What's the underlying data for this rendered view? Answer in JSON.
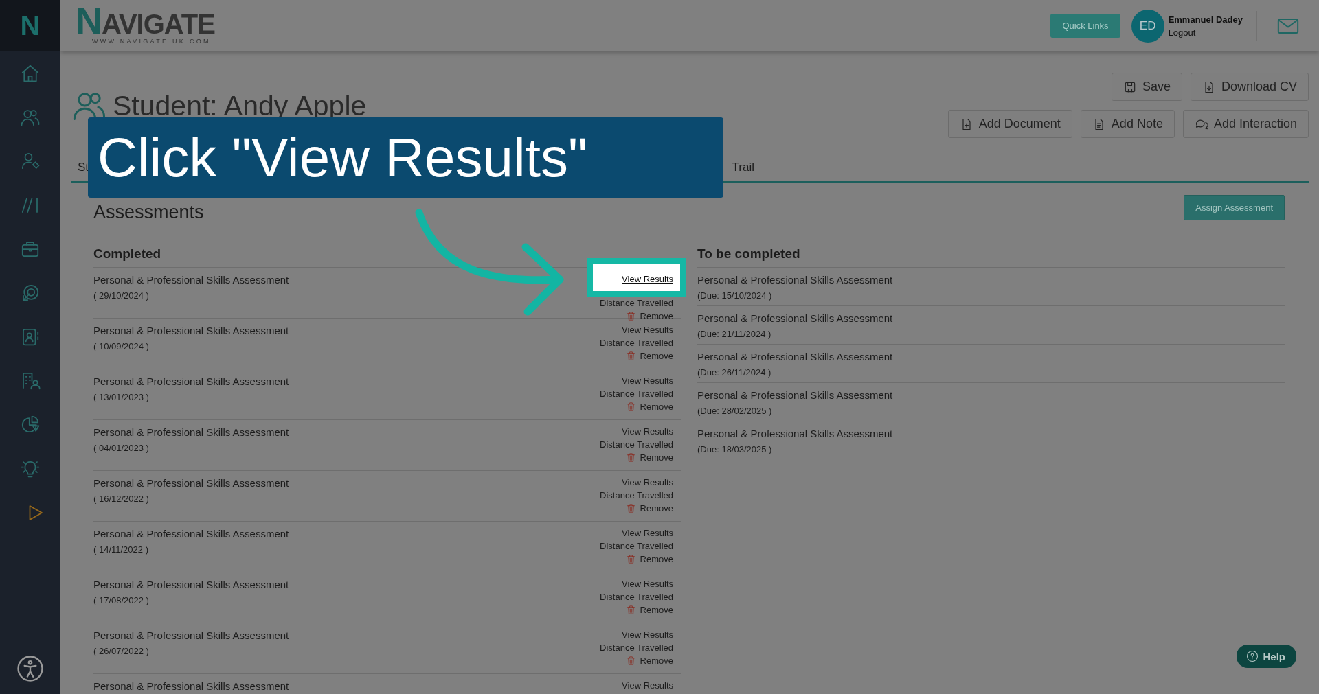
{
  "sidebar": {
    "logo": "N"
  },
  "header": {
    "logo": "NAVIGATE",
    "tagline": "WWW.NAVIGATE.UK.COM",
    "quick_links": "Quick Links",
    "user": {
      "initials": "ED",
      "name": "Emmanuel Dadey",
      "logout": "Logout"
    }
  },
  "student": {
    "title": "Student: Andy Apple",
    "buttons": [
      [
        "Save",
        "Download CV"
      ],
      [
        "Add Document",
        "Add Note",
        "Add Interaction"
      ]
    ]
  },
  "tabs": [
    {
      "label": "St"
    },
    {
      "label": "Trail"
    }
  ],
  "assessments": {
    "title": "Assessments",
    "assign_button": "Assign Assessment",
    "completed": {
      "heading": "Completed",
      "rows": [
        {
          "title": "Personal & Professional Skills Assessment",
          "date": "( 29/10/2024 )",
          "highlighted": true,
          "actions": [
            "View Results",
            "Distance Travelled",
            "Remove"
          ]
        },
        {
          "title": "Personal & Professional Skills Assessment",
          "date": "( 10/09/2024 )",
          "highlighted": false,
          "actions": [
            "View Results",
            "Distance Travelled",
            "Remove"
          ]
        },
        {
          "title": "Personal & Professional Skills Assessment",
          "date": "( 13/01/2023 )",
          "highlighted": false,
          "actions": [
            "View Results",
            "Distance Travelled",
            "Remove"
          ]
        },
        {
          "title": "Personal & Professional Skills Assessment",
          "date": "( 04/01/2023 )",
          "highlighted": false,
          "actions": [
            "View Results",
            "Distance Travelled",
            "Remove"
          ]
        },
        {
          "title": "Personal & Professional Skills Assessment",
          "date": "( 16/12/2022 )",
          "highlighted": false,
          "actions": [
            "View Results",
            "Distance Travelled",
            "Remove"
          ]
        },
        {
          "title": "Personal & Professional Skills Assessment",
          "date": "( 14/11/2022 )",
          "highlighted": false,
          "actions": [
            "View Results",
            "Distance Travelled",
            "Remove"
          ]
        },
        {
          "title": "Personal & Professional Skills Assessment",
          "date": "( 17/08/2022 )",
          "highlighted": false,
          "actions": [
            "View Results",
            "Distance Travelled",
            "Remove"
          ]
        },
        {
          "title": "Personal & Professional Skills Assessment",
          "date": "( 26/07/2022 )",
          "highlighted": false,
          "actions": [
            "View Results",
            "Distance Travelled",
            "Remove"
          ]
        },
        {
          "title": "Personal & Professional Skills Assessment",
          "highlighted": false,
          "actions": [
            "View Results"
          ]
        }
      ]
    },
    "to_complete": {
      "heading": "To be completed",
      "rows": [
        {
          "title": "Personal & Professional Skills Assessment",
          "due": "(Due: 15/10/2024 )"
        },
        {
          "title": "Personal & Professional Skills Assessment",
          "due": "(Due: 21/11/2024 )"
        },
        {
          "title": "Personal & Professional Skills Assessment",
          "due": "(Due: 26/11/2024 )"
        },
        {
          "title": "Personal & Professional Skills Assessment",
          "due": "(Due: 28/02/2025 )"
        },
        {
          "title": "Personal & Professional Skills Assessment",
          "due": "(Due: 18/03/2025 )"
        }
      ]
    }
  },
  "help": "Help",
  "callout": {
    "text": "Click \"View Results\""
  }
}
